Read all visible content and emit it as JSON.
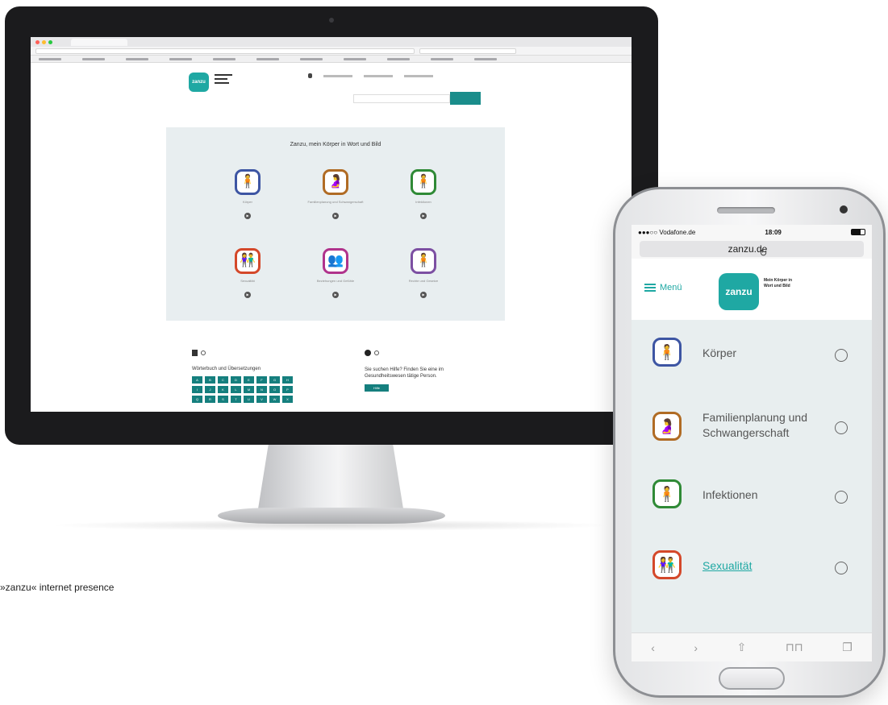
{
  "caption": "»zanzu« internet presence",
  "desktop": {
    "logo": "zanzu",
    "panel_title": "Zanzu, mein Körper in Wort und Bild",
    "categories": [
      {
        "label": "Körper",
        "color": "#3d55a3"
      },
      {
        "label": "Familienplanung und Schwangerschaft",
        "color": "#b06b24"
      },
      {
        "label": "Infektionen",
        "color": "#2f8a36"
      },
      {
        "label": "Sexualität",
        "color": "#d4482a"
      },
      {
        "label": "Beziehungen und Gefühle",
        "color": "#b0338c"
      },
      {
        "label": "Rechte und Gesetze",
        "color": "#7c4fa2"
      }
    ],
    "lower_left_title": "Wörterbuch und Übersetzungen",
    "alphabet": [
      "A",
      "B",
      "C",
      "D",
      "E",
      "F",
      "G",
      "H",
      "I",
      "J",
      "K",
      "L",
      "M",
      "N",
      "O",
      "P",
      "Q",
      "R",
      "S",
      "T",
      "U",
      "V",
      "W",
      "X"
    ],
    "help_text": "Sie suchen Hilfe? Finden Sie eine im Gesundheitswesen tätige Person.",
    "help_button": "Hilfe"
  },
  "phone": {
    "carrier": "●●●○○ Vodafone.de",
    "time": "18:09",
    "url": "zanzu.de",
    "menu_label": "Menü",
    "logo": "zanzu",
    "slogan": "Mein Körper in Wort und Bild",
    "items": [
      {
        "label": "Körper",
        "color": "#3d55a3",
        "link": false
      },
      {
        "label": "Familienplanung und Schwangerschaft",
        "color": "#b06b24",
        "link": false
      },
      {
        "label": "Infektionen",
        "color": "#2f8a36",
        "link": false
      },
      {
        "label": "Sexualität",
        "color": "#d4482a",
        "link": true
      }
    ],
    "toolbar": {
      "back": "‹",
      "forward": "›",
      "share": "⇧",
      "bookmarks": "⊓⊓",
      "tabs": "❐"
    }
  },
  "accent_color": "#1fa8a3"
}
